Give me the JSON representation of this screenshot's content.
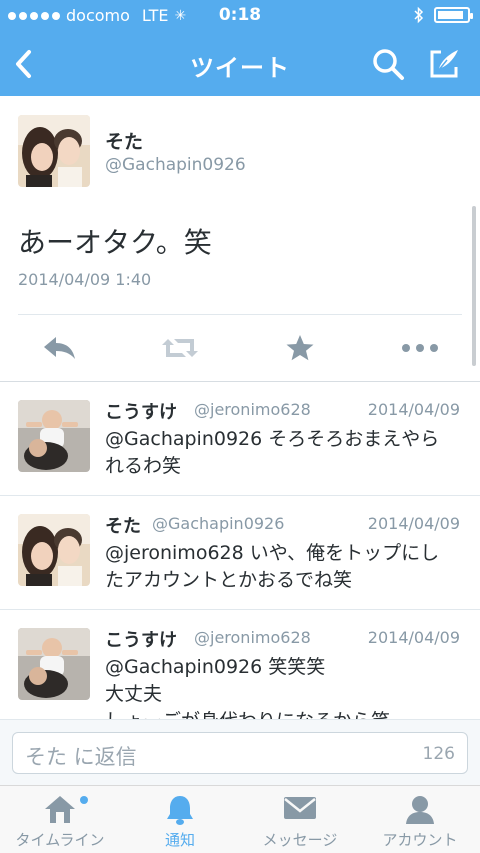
{
  "status": {
    "carrier": "docomo",
    "network": "LTE",
    "time": "0:18",
    "battery_level": 0.9
  },
  "nav": {
    "title": "ツイート",
    "back_icon": "chevron-left-icon",
    "search_icon": "search-icon",
    "compose_icon": "compose-icon"
  },
  "tweet": {
    "name": "そた",
    "handle": "@Gachapin0926",
    "text": "あーオタク。笑",
    "timestamp": "2014/04/09 1:40"
  },
  "replies": [
    {
      "name": "こうすけ",
      "handle": "@jeronimo628",
      "date": "2014/04/09",
      "lines": [
        "@Gachapin0926 そろそろおまえやら",
        "れるわ笑"
      ]
    },
    {
      "name": "そた",
      "handle": "@Gachapin0926",
      "date": "2014/04/09",
      "lines": [
        "@jeronimo628 いや、俺をトップにし",
        "たアカウントとかおるでね笑"
      ]
    },
    {
      "name": "こうすけ",
      "handle": "@jeronimo628",
      "date": "2014/04/09",
      "lines": [
        "@Gachapin0926 笑笑笑",
        "大丈夫",
        "しょーごが身代わりになるから笑"
      ]
    }
  ],
  "reply_box": {
    "placeholder": "そた に返信",
    "remaining": "126"
  },
  "tabs": [
    {
      "label": "タイムライン",
      "icon": "home-icon"
    },
    {
      "label": "通知",
      "icon": "bell-icon"
    },
    {
      "label": "メッセージ",
      "icon": "envelope-icon"
    },
    {
      "label": "アカウント",
      "icon": "person-icon"
    }
  ],
  "colors": {
    "brand": "#55acee",
    "text_muted": "#8899a6",
    "icon_muted": "#8899a6"
  }
}
